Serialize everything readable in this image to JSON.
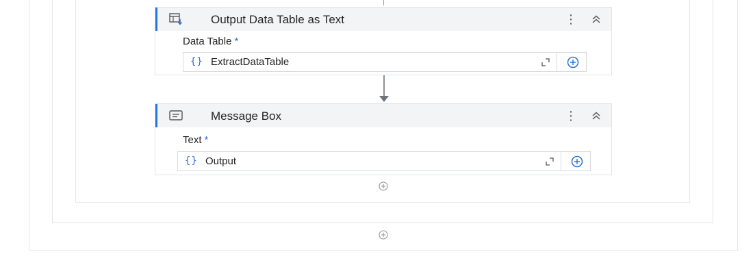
{
  "activities": [
    {
      "title": "Output Data Table as Text",
      "icon": "output-data-table-icon",
      "property_label": "Data Table",
      "required_marker": "*",
      "value": "ExtractDataTable",
      "value_icon": "{}"
    },
    {
      "title": "Message Box",
      "icon": "message-box-icon",
      "property_label": "Text",
      "required_marker": "*",
      "value": "Output",
      "value_icon": "{}"
    }
  ],
  "menu_glyph": "⋮",
  "colors": {
    "accent": "#2b72d8",
    "header_bg": "#f3f4f6",
    "border": "#dfe3e8"
  }
}
